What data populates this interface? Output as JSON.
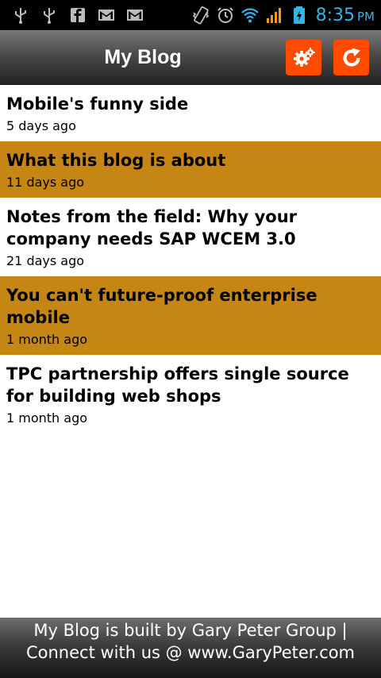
{
  "status_bar": {
    "time": "8:35",
    "ampm": "PM",
    "icons": [
      "usb-icon",
      "usb-icon",
      "facebook-icon",
      "gmail-icon",
      "gmail-icon",
      "vibrate-icon",
      "alarm-icon",
      "wifi-icon",
      "signal-icon",
      "battery-charging-icon"
    ]
  },
  "header": {
    "title": "My Blog",
    "settings_icon": "gear-icon",
    "refresh_icon": "refresh-icon",
    "accent_color": "#ff4a00"
  },
  "posts": [
    {
      "title": "Mobile's funny side",
      "date": "5 days ago"
    },
    {
      "title": "What this blog is about",
      "date": "11 days ago"
    },
    {
      "title": "Notes from the field: Why your company needs SAP WCEM 3.0",
      "date": "21 days ago"
    },
    {
      "title": "You can't future-proof enterprise mobile",
      "date": "1 month ago"
    },
    {
      "title": "TPC partnership offers single source for building web shops",
      "date": "1 month ago"
    }
  ],
  "colors": {
    "alt_row": "#c68613",
    "clock": "#33b5e5"
  },
  "footer": {
    "line1": "My Blog is built by Gary Peter Group |",
    "line2": "Connect with us @ www.GaryPeter.com"
  }
}
